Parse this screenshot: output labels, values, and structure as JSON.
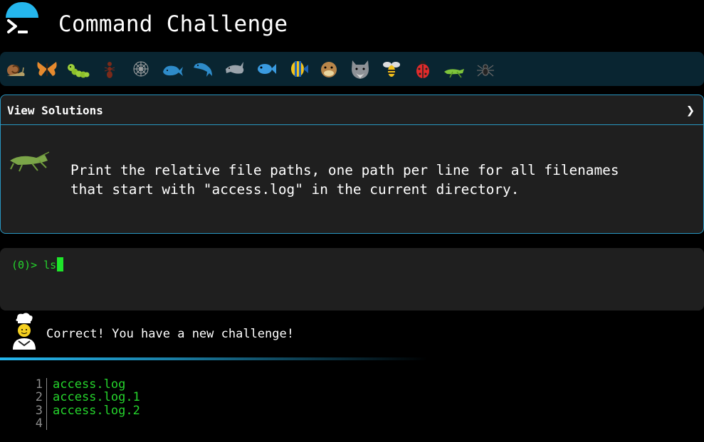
{
  "header": {
    "title": "Command Challenge",
    "icon": "terminal-prompt-icon",
    "accent_color": "#25b7ee"
  },
  "animals": [
    {
      "name": "snail",
      "icon": "snail-icon"
    },
    {
      "name": "butterfly",
      "icon": "butterfly-icon"
    },
    {
      "name": "caterpillar",
      "icon": "caterpillar-icon"
    },
    {
      "name": "ant",
      "icon": "ant-icon"
    },
    {
      "name": "spider-web",
      "icon": "spider-web-icon"
    },
    {
      "name": "whale",
      "icon": "whale-icon"
    },
    {
      "name": "dolphin-blue",
      "icon": "dolphin-icon"
    },
    {
      "name": "dolphin-gray",
      "icon": "dolphin-gray-icon"
    },
    {
      "name": "fish",
      "icon": "fish-icon"
    },
    {
      "name": "tropical-fish",
      "icon": "tropical-fish-icon"
    },
    {
      "name": "pufferfish",
      "icon": "pufferfish-icon"
    },
    {
      "name": "wolf",
      "icon": "wolf-icon"
    },
    {
      "name": "bee",
      "icon": "bee-icon"
    },
    {
      "name": "ladybug",
      "icon": "ladybug-icon"
    },
    {
      "name": "cricket",
      "icon": "cricket-icon"
    },
    {
      "name": "spider",
      "icon": "spider-icon"
    }
  ],
  "challenge": {
    "solutions_label": "View Solutions",
    "chevron": "❯",
    "description": "Print the relative file paths, one path per line for all filenames\nthat start with \"access.log\" in the current directory.",
    "icon": "cricket-icon"
  },
  "terminal": {
    "prompt": "(0)> ",
    "command": "ls"
  },
  "feedback": {
    "message": "Correct! You have a new challenge!",
    "icon": "chef-icon"
  },
  "output": {
    "lines": [
      {
        "num": "1",
        "text": "access.log"
      },
      {
        "num": "2",
        "text": "access.log.1"
      },
      {
        "num": "3",
        "text": "access.log.2"
      },
      {
        "num": "4",
        "text": ""
      }
    ]
  },
  "colors": {
    "panel_border": "#2896c1",
    "terminal_green": "#25d42c",
    "panel_bg": "#1f1f1f",
    "strip_bg": "#092531"
  }
}
